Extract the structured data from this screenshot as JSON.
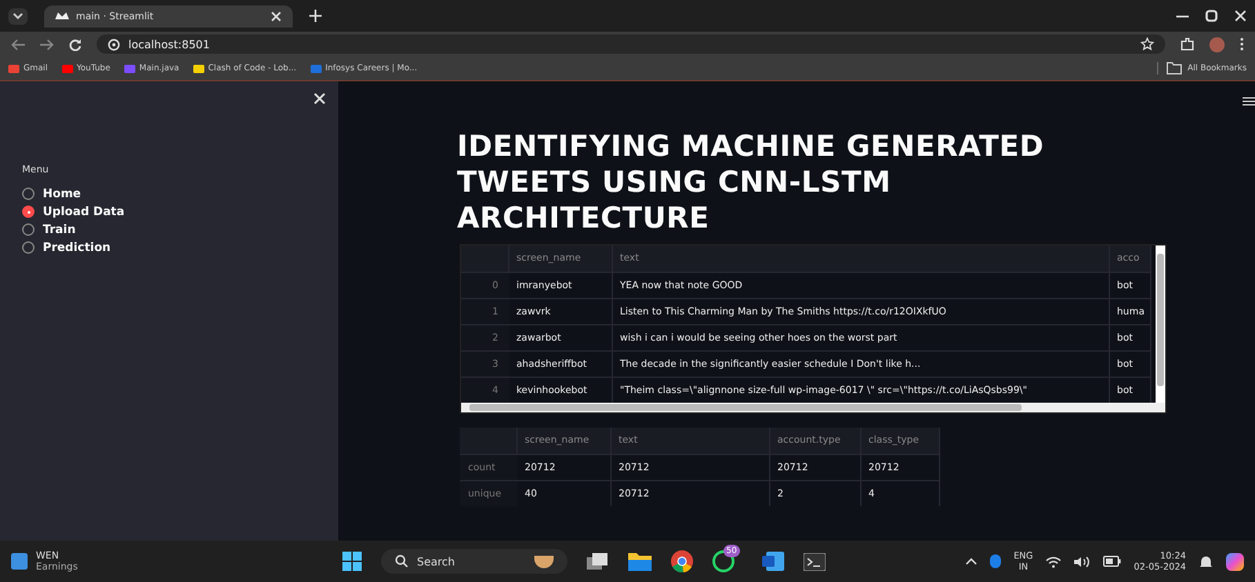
{
  "browser": {
    "tab_title": "main · Streamlit",
    "url": "localhost:8501",
    "bookmarks": [
      {
        "label": "Gmail",
        "color": "#ea4335"
      },
      {
        "label": "YouTube",
        "color": "#ff0000"
      },
      {
        "label": "Main.java",
        "color": "#7c4dff"
      },
      {
        "label": "Clash of Code - Lob...",
        "color": "#f5d000"
      },
      {
        "label": "Infosys Careers | Mo...",
        "color": "#1e6fd9"
      }
    ],
    "all_bookmarks": "All Bookmarks"
  },
  "sidebar": {
    "menu_label": "Menu",
    "items": [
      {
        "label": "Home",
        "selected": false
      },
      {
        "label": "Upload Data",
        "selected": true
      },
      {
        "label": "Train",
        "selected": false
      },
      {
        "label": "Prediction",
        "selected": false
      }
    ]
  },
  "title": "IDENTIFYING MACHINE GENERATED TWEETS USING CNN-LSTM ARCHITECTURE",
  "data_table": {
    "columns": [
      "screen_name",
      "text",
      "acco"
    ],
    "rows": [
      {
        "index": "0",
        "cells": [
          "imranyebot",
          "YEA now that note GOOD",
          "bot"
        ]
      },
      {
        "index": "1",
        "cells": [
          "zawvrk",
          "Listen to This Charming Man by The Smiths  https://t.co/r12OIXkfUO",
          "huma"
        ]
      },
      {
        "index": "2",
        "cells": [
          "zawarbot",
          "wish i can i would be seeing other hoes on the worst part",
          "bot"
        ]
      },
      {
        "index": "3",
        "cells": [
          "ahadsheriffbot",
          "The decade in the significantly easier schedule I Don't like h...",
          "bot"
        ]
      },
      {
        "index": "4",
        "cells": [
          "kevinhookebot",
          "\"Theim class=\\\"alignnone size-full wp-image-6017 \\\" src=\\\"https://t.co/LiAsQsbs99\\\"",
          "bot"
        ]
      }
    ]
  },
  "stats_table": {
    "columns": [
      "screen_name",
      "text",
      "account.type",
      "class_type"
    ],
    "rows": [
      {
        "index": "count",
        "cells": [
          "20712",
          "20712",
          "20712",
          "20712"
        ]
      },
      {
        "index": "unique",
        "cells": [
          "40",
          "20712",
          "2",
          "4"
        ]
      }
    ]
  },
  "taskbar": {
    "widget_title": "WEN",
    "widget_subtitle": "Earnings",
    "search": "Search",
    "chat_badge": "50",
    "language": "ENG",
    "region": "IN",
    "time": "10:24",
    "date": "02-05-2024"
  }
}
